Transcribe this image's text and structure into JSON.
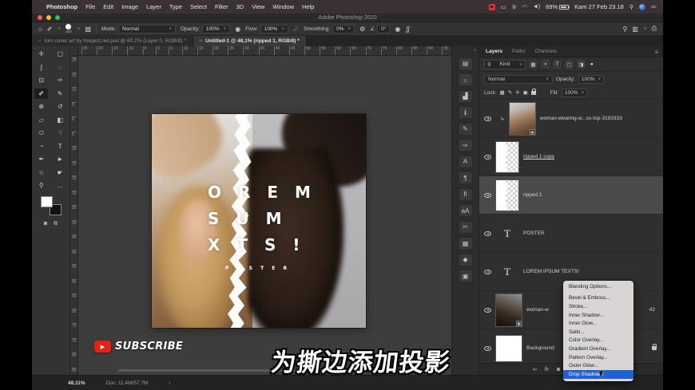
{
  "menubar": {
    "apple": "",
    "items": [
      "Photoshop",
      "File",
      "Edit",
      "Image",
      "Layer",
      "Type",
      "Select",
      "Filter",
      "3D",
      "View",
      "Window",
      "Help"
    ],
    "battery": "69%",
    "clock": "Kam 27 Feb 23.18",
    "wifi_glyph": "◠",
    "volume_glyph": "◄)",
    "keystroke_glyph": "①",
    "search_glyph": "⚲",
    "list_glyph": "≔",
    "display_glyph": "▭"
  },
  "titlebar": {
    "title": "Adobe Photoshop 2020"
  },
  "options": {
    "home_glyph": "⌂",
    "brush_glyph": "✐",
    "brush_size": "300",
    "toggle_panel_glyph": "▨",
    "mode_label": "Mode:",
    "mode_value": "Normal",
    "opacity_label": "Opacity:",
    "opacity_value": "100%",
    "pressure_glyph": "◉",
    "flow_label": "Flow:",
    "flow_value": "100%",
    "airbrush_glyph": "☄",
    "smoothing_label": "Smoothing:",
    "smoothing_value": "0%",
    "gear_glyph": "⚙",
    "angle_label": "∠",
    "angle_value": "0°",
    "symmetry_glyph": "∬",
    "search_glyph": "⚲",
    "workspace_glyph": "▥",
    "share_glyph": "⎙"
  },
  "tabs": {
    "close": "×",
    "tab1": "torn cover art by freeject.net.psd @ 60,2% (Layer 0, RGB/8) *",
    "tab2": "Untitled-1 @ 48,1% (ripped 1, RGB/8) *"
  },
  "toolbar": {
    "tools": [
      {
        "name": "move-tool",
        "glyph": "✛"
      },
      {
        "name": "marquee-tool",
        "glyph": "▢"
      },
      {
        "name": "lasso-tool",
        "glyph": "ʃ"
      },
      {
        "name": "object-selection-tool",
        "glyph": "◌"
      },
      {
        "name": "crop-tool",
        "glyph": "⊡"
      },
      {
        "name": "eyedropper-tool",
        "glyph": "✑"
      },
      {
        "name": "brush-tool",
        "glyph": "✐"
      },
      {
        "name": "pencil-tool",
        "glyph": "✎"
      },
      {
        "name": "clone-stamp-tool",
        "glyph": "⊕"
      },
      {
        "name": "history-brush-tool",
        "glyph": "↺"
      },
      {
        "name": "eraser-tool",
        "glyph": "▱"
      },
      {
        "name": "gradient-tool",
        "glyph": "◧"
      },
      {
        "name": "blur-tool",
        "glyph": "⬭"
      },
      {
        "name": "smudge-tool",
        "glyph": "☟"
      },
      {
        "name": "dodge-tool",
        "glyph": "◔"
      },
      {
        "name": "type-tool",
        "glyph": "T"
      },
      {
        "name": "pen-tool",
        "glyph": "✒"
      },
      {
        "name": "path-select-tool",
        "glyph": "►"
      },
      {
        "name": "shape-tool",
        "glyph": "☆"
      },
      {
        "name": "hand-tool",
        "glyph": "☛"
      },
      {
        "name": "zoom-tool",
        "glyph": "⚲"
      },
      {
        "name": "more-tools",
        "glyph": "…"
      }
    ],
    "mask_glyph": "◙",
    "screen_mode_glyph": "⧉"
  },
  "rulers": {
    "h": [
      "25",
      "20",
      "15",
      "10",
      "5",
      "0",
      "5",
      "10",
      "15",
      "20",
      "25",
      "30",
      "35",
      "40",
      "45",
      "50",
      "55",
      "60",
      "65",
      "70",
      "75",
      "80",
      "85",
      "90",
      "95"
    ],
    "v": [
      "20",
      "15",
      "10",
      "5",
      "0",
      "5",
      "10",
      "15",
      "20",
      "25",
      "30",
      "35",
      "40",
      "45",
      "50",
      "55",
      "60",
      "65",
      "70",
      "75",
      "80",
      "85"
    ]
  },
  "poster": {
    "line1": "O R E M",
    "line2": "S U M",
    "line3": "X T S !",
    "caption": "P O S T E R"
  },
  "dock": {
    "collapse": "»",
    "icons": [
      {
        "name": "swatches-panel-icon",
        "glyph": "▤"
      },
      {
        "name": "learn-panel-icon",
        "glyph": "☼"
      },
      {
        "name": "histogram-panel-icon",
        "glyph": "▟"
      },
      {
        "name": "info-panel-icon",
        "glyph": "ℹ"
      },
      {
        "name": "brush-settings-panel-icon",
        "glyph": "✎"
      },
      {
        "name": "clone-source-panel-icon",
        "glyph": "✑"
      },
      {
        "name": "character-panel-icon",
        "glyph": "A"
      },
      {
        "name": "paragraph-panel-icon",
        "glyph": "¶"
      },
      {
        "name": "glyphs-panel-icon",
        "glyph": "ﬁ"
      },
      {
        "name": "character-styles-panel-icon",
        "glyph": "aA"
      },
      {
        "name": "scissors-panel-icon",
        "glyph": "✂"
      },
      {
        "name": "grid-panel-icon",
        "glyph": "▦"
      },
      {
        "name": "shapes-panel-icon",
        "glyph": "◆"
      },
      {
        "name": "libraries-panel-icon",
        "glyph": "▣"
      }
    ]
  },
  "layers_panel": {
    "tabs": [
      "Layers",
      "Paths",
      "Channels"
    ],
    "menu_icon": "≡",
    "kind_search_glyph": "⚲",
    "kind_label": "Kind",
    "filter_icons": [
      "▦",
      "◑",
      "T",
      "▢",
      "◨"
    ],
    "filter_toggle": "●",
    "blend_value": "Normal",
    "opacity_label": "Opacity:",
    "opacity_value": "100%",
    "lock_label": "Lock:",
    "lock_icons": [
      "▦",
      "✎",
      "✛",
      "▣"
    ],
    "fill_label": "Fill:",
    "fill_value": "100%",
    "clip_arrow": "↳",
    "so_badge": "▣",
    "layers": [
      {
        "name": "woman-wearing-w...ss-top-3193333"
      },
      {
        "name": "ripped 1 copy"
      },
      {
        "name": "ripped 1"
      },
      {
        "name": "POSTER"
      },
      {
        "name": "LOREM IPSUM TEXTS!"
      },
      {
        "name": "woman-w",
        "suffix": "42"
      },
      {
        "name": "Background"
      }
    ],
    "bottom_icons": [
      {
        "name": "link-layers-icon",
        "glyph": "∞"
      },
      {
        "name": "layer-style-fx-icon",
        "glyph": "fx"
      },
      {
        "name": "add-mask-icon",
        "glyph": "◙"
      },
      {
        "name": "adjustment-layer-icon",
        "glyph": "◑"
      },
      {
        "name": "new-group-icon",
        "glyph": "▱"
      },
      {
        "name": "new-layer-icon",
        "glyph": "⊞"
      },
      {
        "name": "delete-layer-icon",
        "glyph": "▥"
      }
    ]
  },
  "context_menu": {
    "items": [
      "Blending Options...",
      "Bevel & Emboss...",
      "Stroke...",
      "Inner Shadow...",
      "Inner Glow...",
      "Satin...",
      "Color Overlay...",
      "Gradient Overlay...",
      "Pattern Overlay...",
      "Outer Glow...",
      "Drop Shadow..."
    ]
  },
  "statusbar": {
    "zoom": "48,11%",
    "doc": "Doc: 11,4M/57,7M",
    "chevron": "›"
  },
  "overlays": {
    "subscribe": "SUBSCRIBE",
    "subtitle": "为撕边添加投影"
  },
  "colors": {
    "accent_blue": "#1f63d2",
    "record_red": "#d63434",
    "yt_red": "#e62117",
    "selected_row": "#4a4a4a"
  }
}
